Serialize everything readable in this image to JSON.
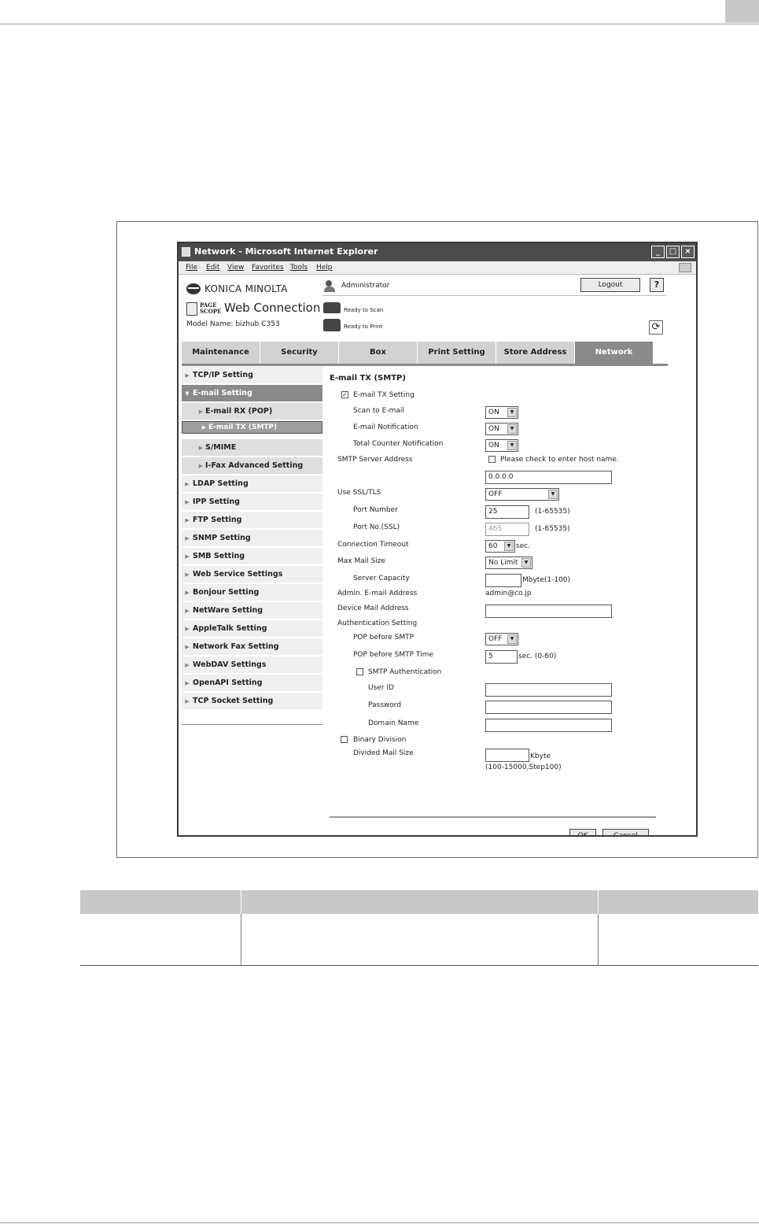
{
  "window": {
    "title": "Network - Microsoft Internet Explorer",
    "minimize_label": "_",
    "maximize_label": "□",
    "close_label": "×"
  },
  "menu": [
    "File",
    "Edit",
    "View",
    "Favorites",
    "Tools",
    "Help"
  ],
  "header": {
    "brand": "KONICA MINOLTA",
    "pagescope_line1": "PAGE",
    "pagescope_line2": "SCOPE",
    "product": "Web Connection",
    "model": "Model Name: bizhub C353",
    "user": "Administrator",
    "logout": "Logout",
    "help": "?",
    "scan_status": "Ready to Scan",
    "print_status": "Ready to Print",
    "refresh": "⟳"
  },
  "tabs": [
    "Maintenance",
    "Security",
    "Box",
    "Print Setting",
    "Store Address",
    "Network"
  ],
  "sidebar": {
    "items": [
      "TCP/IP Setting",
      "E-mail Setting",
      "E-mail RX (POP)",
      "E-mail TX (SMTP)",
      "S/MIME",
      "I-Fax Advanced Setting",
      "LDAP Setting",
      "IPP Setting",
      "FTP Setting",
      "SNMP Setting",
      "SMB Setting",
      "Web Service Settings",
      "Bonjour Setting",
      "NetWare Setting",
      "AppleTalk Setting",
      "Network Fax Setting",
      "WebDAV Settings",
      "OpenAPI Setting",
      "TCP Socket Setting"
    ]
  },
  "form": {
    "title": "E-mail TX (SMTP)",
    "email_tx_setting": {
      "label": "E-mail TX Setting",
      "checked": "✓"
    },
    "scan_to_email": {
      "label": "Scan to E-mail",
      "value": "ON"
    },
    "email_notification": {
      "label": "E-mail Notification",
      "value": "ON"
    },
    "total_counter_notification": {
      "label": "Total Counter Notification",
      "value": "ON"
    },
    "smtp_server_address": {
      "label": "SMTP Server Address",
      "host_check_label": "Please check to enter host name.",
      "value": "0.0.0.0"
    },
    "use_ssl_tls": {
      "label": "Use SSL/TLS",
      "value": "OFF"
    },
    "port_number": {
      "label": "Port Number",
      "value": "25",
      "range": "(1-65535)"
    },
    "port_no_ssl": {
      "label": "Port No.(SSL)",
      "value": "465",
      "range": "(1-65535)"
    },
    "connection_timeout": {
      "label": "Connection Timeout",
      "value": "60",
      "unit": "sec."
    },
    "max_mail_size": {
      "label": "Max Mail Size",
      "value": "No Limit"
    },
    "server_capacity": {
      "label": "Server Capacity",
      "unit": "Mbyte(1-100)"
    },
    "admin_email": {
      "label": "Admin. E-mail Address",
      "value": "admin@co.jp"
    },
    "device_mail_address": {
      "label": "Device Mail Address"
    },
    "authentication_setting": {
      "label": "Authentication Setting"
    },
    "pop_before_smtp": {
      "label": "POP before SMTP",
      "value": "OFF"
    },
    "pop_before_smtp_time": {
      "label": "POP before SMTP Time",
      "value": "5",
      "unit": "sec. (0-60)"
    },
    "smtp_authentication": {
      "label": "SMTP Authentication"
    },
    "user_id": {
      "label": "User ID"
    },
    "password": {
      "label": "Password"
    },
    "domain_name": {
      "label": "Domain Name"
    },
    "binary_division": {
      "label": "Binary Division"
    },
    "divided_mail_size": {
      "label": "Divided Mail Size",
      "unit": "Kbyte",
      "range": "(100-15000,Step100)"
    },
    "ok": "OK",
    "cancel": "Cancel",
    "dropdown_arrow": "▼"
  }
}
